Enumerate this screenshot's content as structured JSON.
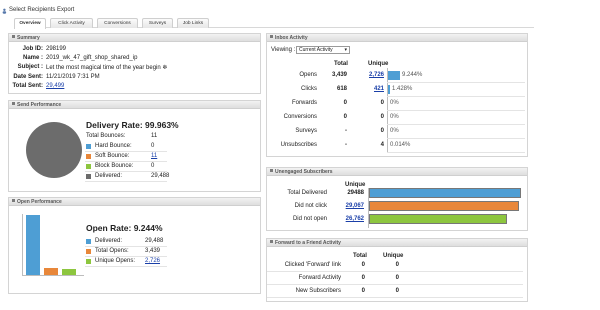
{
  "toolbar": {
    "select_recipients": "Select Recipients",
    "export": "Export"
  },
  "tabs": [
    "Overview",
    "Click Activity",
    "Conversions",
    "Surveys",
    "Job Links"
  ],
  "summary": {
    "title": "Summary",
    "rows": [
      {
        "label": "Job ID:",
        "value": "298199",
        "link": false
      },
      {
        "label": "Name :",
        "value": "2019_wk_47_gift_shop_shared_ip",
        "link": false
      },
      {
        "label": "Subject :",
        "value": "Let the most magical time of the year begin ❄",
        "link": false
      },
      {
        "label": "Date Sent:",
        "value": "11/21/2019 7:31 PM",
        "link": false
      },
      {
        "label": "Total Sent:",
        "value": "29,499",
        "link": true
      }
    ]
  },
  "send_performance": {
    "title": "Send Performance",
    "headline": "Delivery Rate: 99.963%",
    "total_bounces_label": "Total Bounces:",
    "total_bounces_value": "11",
    "legend": [
      {
        "label": "Hard Bounce:",
        "value": "0",
        "color": "#4e9ed4",
        "link": false
      },
      {
        "label": "Soft Bounce:",
        "value": "11",
        "color": "#e8873a",
        "link": true
      },
      {
        "label": "Block Bounce:",
        "value": "0",
        "color": "#8dc63f",
        "link": false
      },
      {
        "label": "Delivered:",
        "value": "29,488",
        "color": "#6c6c6c",
        "link": false
      }
    ]
  },
  "open_performance": {
    "title": "Open Performance",
    "headline": "Open Rate: 9.244%",
    "legend": [
      {
        "label": "Delivered:",
        "value": "29,488",
        "color": "#4e9ed4",
        "link": false
      },
      {
        "label": "Total Opens:",
        "value": "3,439",
        "color": "#e8873a",
        "link": false
      },
      {
        "label": "Unique Opens:",
        "value": "2,726",
        "color": "#8dc63f",
        "link": true
      }
    ],
    "bar_levels": [
      1.0,
      0.1166,
      0.0924
    ]
  },
  "inbox_activity": {
    "title": "Inbox Activity",
    "viewing_label": "Viewing :",
    "viewing_value": "Current Activity",
    "col_total": "Total",
    "col_unique": "Unique",
    "rows": [
      {
        "label": "Opens",
        "total": "3,439",
        "unique": "2,726",
        "unique_link": true,
        "pct": "9.244%",
        "fraction": 0.09244
      },
      {
        "label": "Clicks",
        "total": "618",
        "unique": "421",
        "unique_link": true,
        "pct": "1.428%",
        "fraction": 0.01428
      },
      {
        "label": "Forwards",
        "total": "0",
        "unique": "0",
        "unique_link": false,
        "pct": "0%",
        "fraction": 0
      },
      {
        "label": "Conversions",
        "total": "0",
        "unique": "0",
        "unique_link": false,
        "pct": "0%",
        "fraction": 0
      },
      {
        "label": "Surveys",
        "total": "-",
        "unique": "0",
        "unique_link": false,
        "pct": "0%",
        "fraction": 0
      },
      {
        "label": "Unsubscribes",
        "total": "-",
        "unique": "4",
        "unique_link": false,
        "pct": "0.014%",
        "fraction": 0.00014
      }
    ]
  },
  "unengaged": {
    "title": "Unengaged Subscribers",
    "col_unique": "Unique",
    "rows": [
      {
        "label": "Total Delivered",
        "value": "29488",
        "link": false,
        "color": "#4e9ed4",
        "fraction": 1.0
      },
      {
        "label": "Did not click",
        "value": "29,067",
        "link": true,
        "color": "#e8873a",
        "fraction": 0.9857
      },
      {
        "label": "Did not open",
        "value": "26,762",
        "link": true,
        "color": "#8dc63f",
        "fraction": 0.9076
      }
    ]
  },
  "forward_friend": {
    "title": "Forward to a Friend Activity",
    "col_total": "Total",
    "col_unique": "Unique",
    "rows": [
      {
        "label": "Clicked 'Forward' link",
        "total": "0",
        "unique": "0"
      },
      {
        "label": "Forward Activity",
        "total": "0",
        "unique": "0"
      },
      {
        "label": "New Subscribers",
        "total": "0",
        "unique": "0"
      }
    ]
  }
}
